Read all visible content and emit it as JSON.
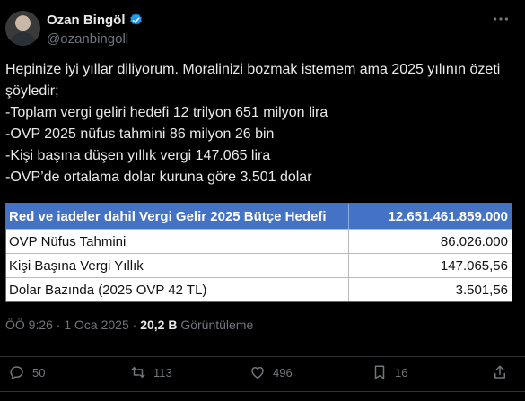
{
  "post": {
    "author_name": "Ozan Bingöl",
    "author_handle": "@ozanbingoll",
    "text": "Hepinize iyi yıllar diliyorum. Moralinizi bozmak istemem ama 2025 yılının özeti şöyledir;\n-Toplam vergi geliri hedefi 12 trilyon 651 milyon lira\n-OVP 2025 nüfus tahmini 86 milyon 26 bin\n-Kişi başına düşen yıllık vergi 147.065 lira\n-OVP’de ortalama dolar kuruna göre 3.501 dolar",
    "table": [
      {
        "label": "Red ve iadeler dahil Vergi Gelir 2025 Bütçe  Hedefi",
        "value": "12.651.461.859.000"
      },
      {
        "label": "OVP Nüfus Tahmini",
        "value": "86.026.000"
      },
      {
        "label": "Kişi Başına Vergi Yıllık",
        "value": "147.065,56"
      },
      {
        "label": "Dolar Bazında (2025 OVP 42 TL)",
        "value": "3.501,56"
      }
    ],
    "time": "ÖÖ 9:26 · 1 Oca 2025 · ",
    "views_count": "20,2 B",
    "views_label": " Görüntüleme"
  },
  "actions": {
    "reply": "50",
    "repost": "113",
    "like": "496",
    "bookmark": "16"
  },
  "colors": {
    "background": "#000000",
    "text": "#e7e9ea",
    "muted": "#71767b",
    "verified": "#1d9bf0",
    "table_header": "#4472c4"
  }
}
